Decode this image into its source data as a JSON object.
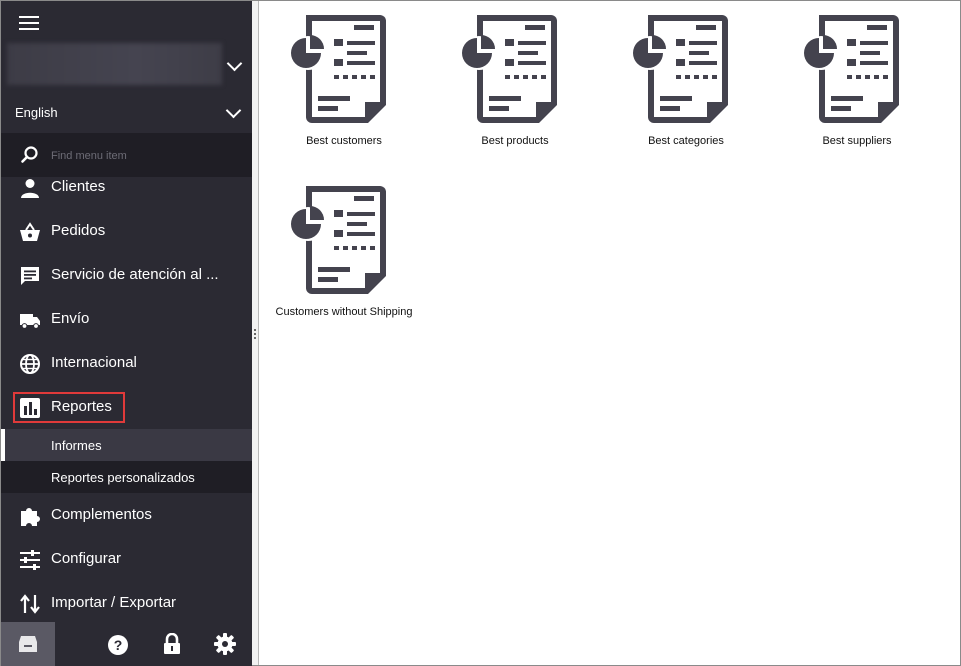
{
  "sidebar": {
    "language": "English",
    "search_placeholder": "Find menu item",
    "items": [
      {
        "label": "Clientes",
        "icon": "person-icon"
      },
      {
        "label": "Pedidos",
        "icon": "basket-icon"
      },
      {
        "label": "Servicio de atención al ...",
        "icon": "chat-icon"
      },
      {
        "label": "Envío",
        "icon": "truck-icon"
      },
      {
        "label": "Internacional",
        "icon": "globe-icon"
      },
      {
        "label": "Reportes",
        "icon": "bar-chart-icon"
      },
      {
        "label": "Complementos",
        "icon": "puzzle-icon"
      },
      {
        "label": "Configurar",
        "icon": "sliders-icon"
      },
      {
        "label": "Importar / Exportar",
        "icon": "import-export-icon"
      }
    ],
    "subitems": [
      {
        "label": "Informes"
      },
      {
        "label": "Reportes personalizados"
      }
    ],
    "footer": [
      "archive-icon",
      "help-icon",
      "lock-icon",
      "gear-icon"
    ]
  },
  "reports": [
    {
      "label": "Best customers"
    },
    {
      "label": "Best products"
    },
    {
      "label": "Best categories"
    },
    {
      "label": "Best suppliers"
    },
    {
      "label": "Customers without Shipping"
    }
  ],
  "colors": {
    "sidebar_bg": "#2b2a33",
    "highlight": "#e03a3a",
    "icon": "#44434e"
  }
}
